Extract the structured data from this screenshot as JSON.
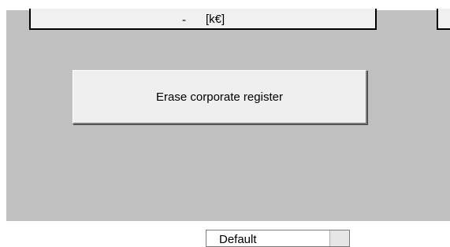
{
  "value_cell": {
    "dash": "-",
    "unit": "[k€]"
  },
  "erase_button": {
    "label": "Erase corporate register"
  },
  "dropdown": {
    "selected": "Default"
  }
}
